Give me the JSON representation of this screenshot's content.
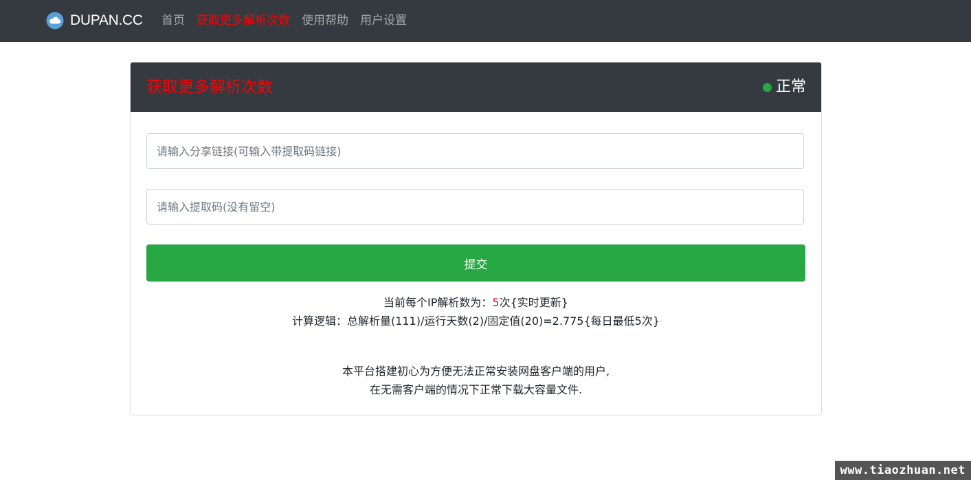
{
  "navbar": {
    "brand": "DUPAN.CC",
    "brand_icon": "cloud-icon",
    "links": [
      {
        "label": "首页",
        "active": false
      },
      {
        "label": "获取更多解析次数",
        "active": true
      },
      {
        "label": "使用帮助",
        "active": false
      },
      {
        "label": "用户设置",
        "active": false
      }
    ]
  },
  "card": {
    "title": "获取更多解析次数",
    "status": {
      "label": "正常",
      "color": "#28a745"
    },
    "link_input": {
      "placeholder": "请输入分享链接(可输入带提取码链接)",
      "value": ""
    },
    "code_input": {
      "placeholder": "请输入提取码(没有留空)",
      "value": ""
    },
    "submit_label": "提交",
    "quota": {
      "prefix": "当前每个IP解析数为：",
      "count": "5",
      "suffix": "次{实时更新}"
    },
    "formula": "计算逻辑：总解析量(111)/运行天数(2)/固定值(20)=2.775{每日最低5次}",
    "intro_line1": "本平台搭建初心为方便无法正常安装网盘客户端的用户,",
    "intro_line2": "在无需客户端的情况下正常下载大容量文件."
  },
  "watermark": "www.tiaozhuan.net",
  "colors": {
    "navbar_bg": "#343a40",
    "accent_red": "#ff0000",
    "success_green": "#28a745"
  }
}
